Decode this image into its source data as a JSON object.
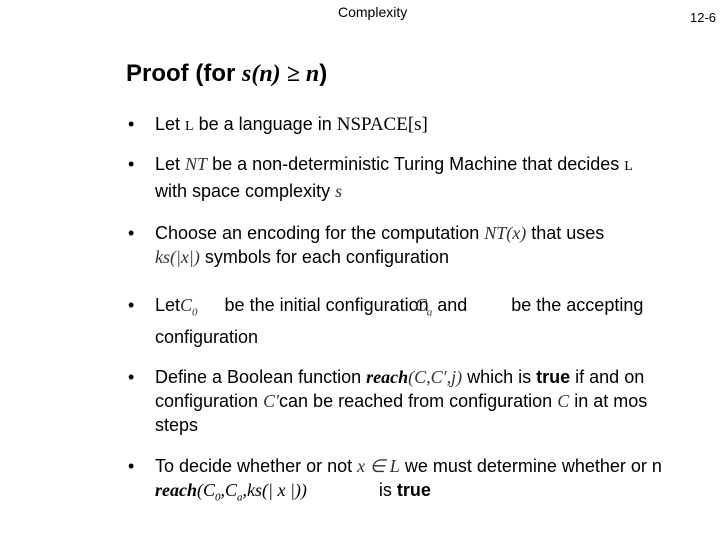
{
  "header": {
    "title": "Complexity",
    "page": "12-6"
  },
  "slide": {
    "title_prefix": "Proof  (for ",
    "title_math": "s(n) ≥ n",
    "title_suffix": ")",
    "bullets": [
      {
        "t1": "Let ",
        "m1": "L",
        "t2": " be a language in ",
        "m2": "NSPACE[s]"
      },
      {
        "t1": "Let ",
        "m1": "NT",
        "t2": " be a non-deterministic Turing Machine that decides ",
        "m2": "L",
        "l2": "with space complexity ",
        "m3": "s"
      },
      {
        "t1": "Choose an encoding for the computation ",
        "m1": "NT(x)",
        "t2": " that uses",
        "m2": "ks(|x|)",
        "l2": " symbols for each configuration"
      },
      {
        "t1": "Let",
        "m1": "C",
        "s1": "0",
        "t2": " be the initial configuration",
        "m2": "C",
        "s2": "a",
        "t3": " and",
        "t4": "be the accepting",
        "l2": "configuration"
      },
      {
        "t1": "Define a Boolean function ",
        "m1": "reach",
        "m1b": "(C,C′,j)",
        "t2": " which is ",
        "b1": "true",
        "t3": " if and on",
        "l2a": "configuration ",
        "m2": "C′",
        "l2b": "can be reached from configuration ",
        "m3": "C",
        "m3b": " in",
        "l2c": " at mos",
        "l3": "steps"
      },
      {
        "t1": "To decide whether or not ",
        "m1": "x ∈ L",
        "t2": " we must determine whether or n",
        "m2": "reach",
        "m2b": "(C",
        "s1": "0",
        "m2c": ",C",
        "s2": "a",
        "m2d": ",ks(| x |))",
        "t3": "is ",
        "b1": "true"
      }
    ],
    "bullet_glyph": "•"
  }
}
